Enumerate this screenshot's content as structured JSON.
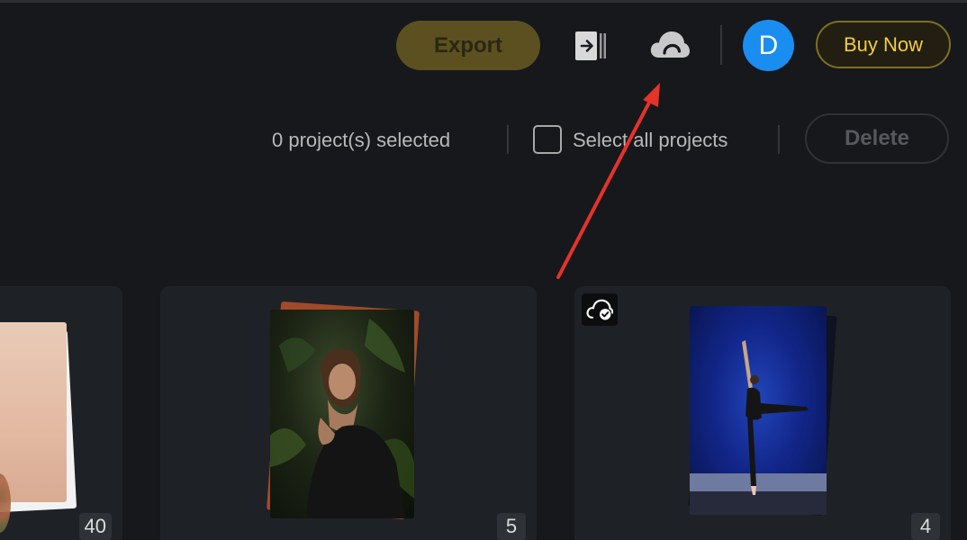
{
  "toolbar": {
    "export_label": "Export",
    "import_icon": "import-icon",
    "cloud_icon": "cloud-icon",
    "avatar_initial": "D",
    "buy_now_label": "Buy Now"
  },
  "selection_bar": {
    "selected_text": "0 project(s) selected",
    "select_all_label": "Select all projects",
    "select_all_checked": false,
    "delete_label": "Delete"
  },
  "projects": [
    {
      "count": "40",
      "cloud_synced": false
    },
    {
      "count": "5",
      "cloud_synced": false
    },
    {
      "count": "4",
      "cloud_synced": true
    }
  ],
  "colors": {
    "background": "#16181b",
    "card": "#1e2226",
    "accent_yellow": "#f2cd3c",
    "avatar_blue": "#1a8df0",
    "annotation_arrow": "#e5322b"
  }
}
